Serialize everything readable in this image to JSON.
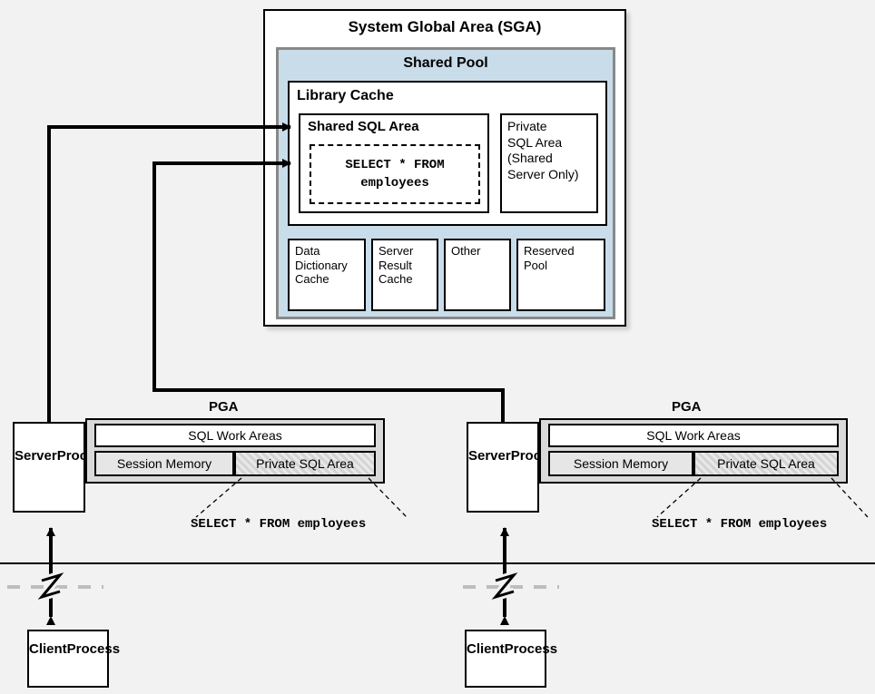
{
  "sga": {
    "title": "System Global Area (SGA)",
    "shared_pool": {
      "title": "Shared Pool",
      "library_cache": {
        "title": "Library Cache",
        "shared_sql_area": {
          "title": "Shared SQL Area",
          "sql_line1": "SELECT * FROM",
          "sql_line2": "employees"
        },
        "private_sql_area": "Private\nSQL Area\n(Shared\nServer Only)"
      },
      "bottom_boxes": {
        "data_dictionary_cache": "Data\nDictionary\nCache",
        "server_result_cache": "Server\nResult\nCache",
        "other": "Other",
        "reserved_pool": "Reserved\nPool"
      }
    }
  },
  "pga": {
    "label": "PGA",
    "server_process": "Server\nProcess",
    "sql_work_areas": "SQL Work Areas",
    "session_memory": "Session Memory",
    "private_sql_area": "Private SQL Area",
    "sql_text": "SELECT * FROM employees"
  },
  "client": {
    "label": "Client\nProcess"
  }
}
